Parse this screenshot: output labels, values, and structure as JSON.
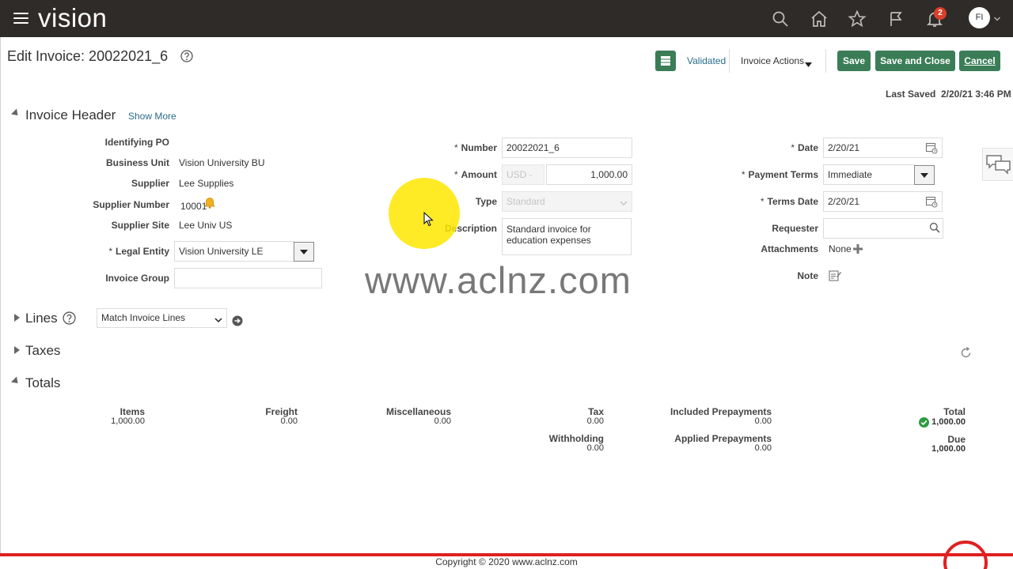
{
  "topbar": {
    "brand": "vision",
    "notification_count": "2",
    "avatar_initials": "FI"
  },
  "header": {
    "title": "Edit Invoice: 20022021_6",
    "status": "Validated",
    "invoice_actions": "Invoice Actions",
    "save": "Save",
    "save_and_close": "Save and Close",
    "cancel": "Cancel",
    "last_saved_label": "Last Saved",
    "last_saved_value": "2/20/21 3:46 PM"
  },
  "invoice_header": {
    "section_title": "Invoice Header",
    "show_more": "Show More",
    "identifying_po_label": "Identifying PO",
    "business_unit_label": "Business Unit",
    "business_unit": "Vision University BU",
    "supplier_label": "Supplier",
    "supplier": "Lee Supplies",
    "supplier_number_label": "Supplier Number",
    "supplier_number": "10001",
    "supplier_site_label": "Supplier Site",
    "supplier_site": "Lee Univ US",
    "legal_entity_label": "Legal Entity",
    "legal_entity": "Vision University LE",
    "invoice_group_label": "Invoice Group",
    "invoice_group": "",
    "number_label": "Number",
    "number": "20022021_6",
    "amount_label": "Amount",
    "currency": "USD -",
    "amount": "1,000.00",
    "type_label": "Type",
    "type": "Standard",
    "description_label": "Description",
    "description": "Standard invoice for education expenses",
    "date_label": "Date",
    "date": "2/20/21",
    "payment_terms_label": "Payment Terms",
    "payment_terms": "Immediate",
    "terms_date_label": "Terms Date",
    "terms_date": "2/20/21",
    "requester_label": "Requester",
    "requester": "",
    "attachments_label": "Attachments",
    "attachments": "None",
    "note_label": "Note",
    "required_mark": "*"
  },
  "lines": {
    "section_title": "Lines",
    "match_option": "Match Invoice Lines"
  },
  "taxes": {
    "section_title": "Taxes"
  },
  "totals": {
    "section_title": "Totals",
    "items_label": "Items",
    "items": "1,000.00",
    "freight_label": "Freight",
    "freight": "0.00",
    "misc_label": "Miscellaneous",
    "misc": "0.00",
    "tax_label": "Tax",
    "tax": "0.00",
    "withholding_label": "Withholding",
    "withholding": "0.00",
    "included_prepayments_label": "Included Prepayments",
    "included_prepayments": "0.00",
    "applied_prepayments_label": "Applied Prepayments",
    "applied_prepayments": "0.00",
    "total_label": "Total",
    "total": "1,000.00",
    "due_label": "Due",
    "due": "1,000.00"
  },
  "overlay": {
    "watermark": "www.aclnz.com",
    "footer": "Copyright © 2020 www.aclnz.com"
  },
  "colors": {
    "topbar": "#2f2b28",
    "button_green": "#3a7d56",
    "link_blue": "#2a6c8c",
    "footer_red": "#e02020",
    "badge_red": "#d93f2a"
  }
}
